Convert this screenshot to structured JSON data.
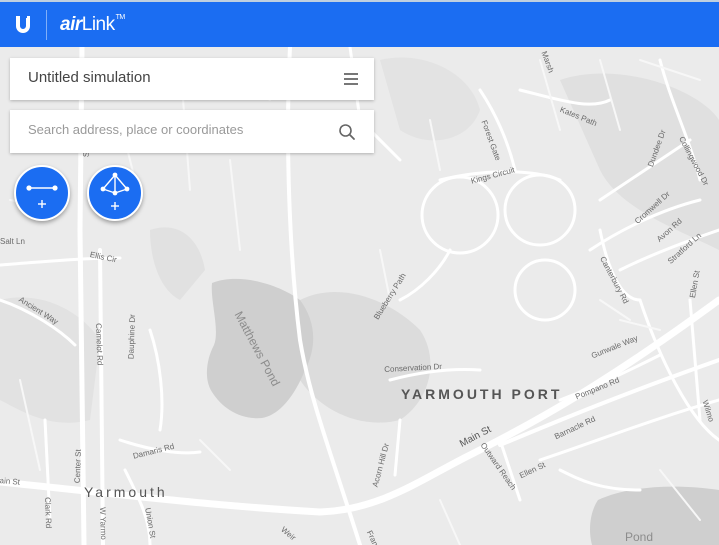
{
  "header": {
    "logo_letter": "U",
    "brand_air": "air",
    "brand_link": "Link",
    "brand_tm": "TM",
    "bar_color": "#1b6df2"
  },
  "simulation": {
    "title": "Untitled simulation",
    "menu_icon": "hamburger-menu-icon"
  },
  "search": {
    "placeholder": "Search address, place or coordinates",
    "value": "",
    "icon": "search-icon"
  },
  "tools": [
    {
      "name": "add-link-button",
      "icon": "point-to-point-link-icon",
      "badge": "+"
    },
    {
      "name": "add-network-button",
      "icon": "point-to-multipoint-network-icon",
      "badge": "+"
    }
  ],
  "map": {
    "places": {
      "yarmouth_port": "YARMOUTH PORT",
      "yarmouth": "Yarmouth"
    },
    "water": {
      "matthews_pond": "Matthews Pond",
      "pond_east": "Pond"
    },
    "streets": {
      "marsh": "Marsh",
      "kates_path": "Kates Path",
      "forest_gate": "Forest Gate",
      "kings_circuit": "Kings Circuit",
      "collingwood": "Collingwood Dr",
      "dundee": "Dundee Dr",
      "cromwell": "Cromwell Dr",
      "avon": "Avon Rd",
      "stratford": "Stratford Ln",
      "canterbury": "Canterbury Rd",
      "ellen_st_e": "Ellen St",
      "salt_ln": "Salt Ln",
      "ellis_cir": "Ellis Cir",
      "ancient_way": "Ancient Way",
      "camelot": "Camelot Rd",
      "dauphine": "Dauphine Dr",
      "blueberry": "Blueberry Path",
      "conservation": "Conservation Dr",
      "gunwale": "Gunwale Way",
      "pompano": "Pompano Rd",
      "barnacle": "Barnacle Rd",
      "wilmont": "Wilmo",
      "acorn_hill": "Acorn Hill Dr",
      "main_st": "Main St",
      "outward_reach": "Outward Reach",
      "ellen_st": "Ellen St",
      "damaris": "Damaris Rd",
      "center_st": "Center St",
      "clark_rd": "Clark Rd",
      "w_yarmouth": "W Yarmo",
      "union_st": "Union St",
      "main_left": "ain St",
      "weir": "Weir",
      "fran": "Fran",
      "school": "St"
    }
  }
}
